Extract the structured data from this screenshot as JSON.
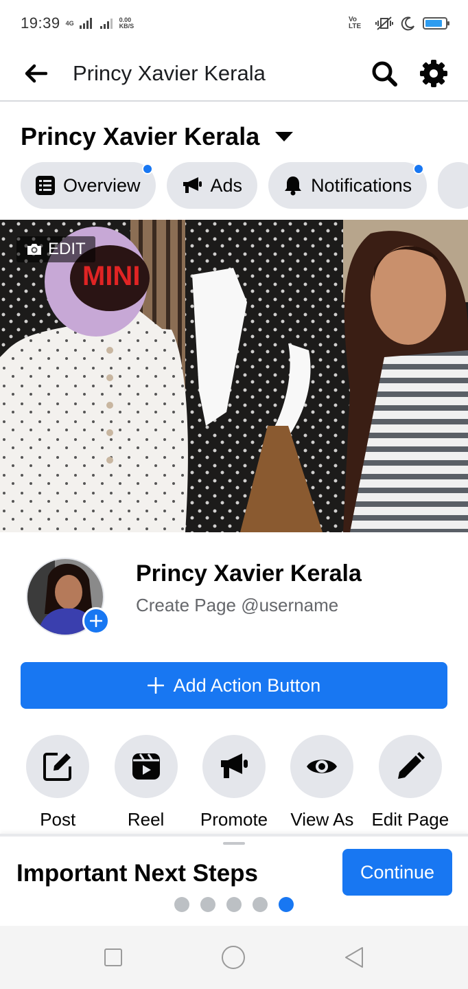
{
  "status_bar": {
    "time": "19:39",
    "network_type": "4G",
    "data_speed_value": "0.00",
    "data_speed_unit": "KB/S",
    "volte": "Vo LTE",
    "battery_level": 0.85
  },
  "top_bar": {
    "title": "Princy Xavier Kerala",
    "back_icon": "back-arrow-icon",
    "search_icon": "search-icon",
    "settings_icon": "gear-icon"
  },
  "page_header": {
    "name": "Princy Xavier Kerala",
    "dropdown_icon": "caret-down-icon"
  },
  "tabs": [
    {
      "label": "Overview",
      "icon": "list-icon",
      "has_dot": true
    },
    {
      "label": "Ads",
      "icon": "megaphone-icon",
      "has_dot": false
    },
    {
      "label": "Notifications",
      "icon": "bell-icon",
      "has_dot": true
    }
  ],
  "cover": {
    "edit_label": "EDIT",
    "sign_text": "MINI"
  },
  "profile": {
    "name": "Princy Xavier Kerala",
    "subtitle": "Create Page @username"
  },
  "action_button": {
    "label": "Add Action Button"
  },
  "quick_actions": [
    {
      "label": "Post",
      "icon": "compose-icon"
    },
    {
      "label": "Reel",
      "icon": "reel-icon"
    },
    {
      "label": "Promote",
      "icon": "megaphone-icon"
    },
    {
      "label": "View As",
      "icon": "eye-icon"
    },
    {
      "label": "Edit Page",
      "icon": "pencil-icon"
    }
  ],
  "next_steps": {
    "title": "Important Next Steps",
    "continue_label": "Continue",
    "total_steps": 5,
    "current_step": 5
  },
  "colors": {
    "accent": "#1877f2",
    "chip_bg": "#e4e6eb",
    "secondary_text": "#65676b"
  }
}
